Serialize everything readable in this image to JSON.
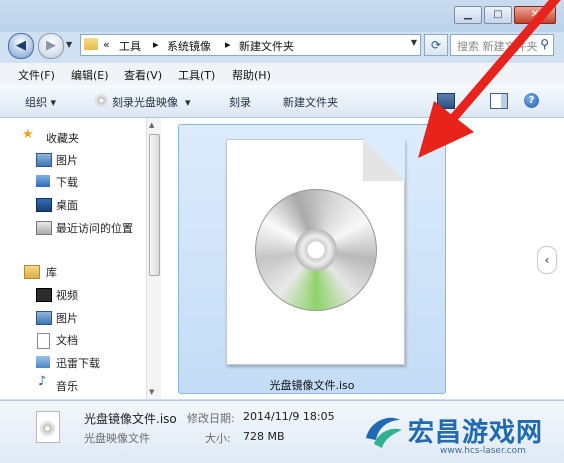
{
  "window": {
    "caption_buttons": [
      "minimize",
      "maximize",
      "close"
    ]
  },
  "address": {
    "overflow": "«",
    "crumbs": [
      "工具",
      "系统镜像",
      "新建文件夹"
    ],
    "search_placeholder": "搜索 新建文件夹"
  },
  "menu": [
    "文件(F)",
    "编辑(E)",
    "查看(V)",
    "工具(T)",
    "帮助(H)"
  ],
  "toolbar": {
    "organize": "组织",
    "burn_image": "刻录光盘映像",
    "burn": "刻录",
    "new_folder": "新建文件夹"
  },
  "nav": {
    "favorites": {
      "header": "收藏夹",
      "items": [
        "图片",
        "下载",
        "桌面",
        "最近访问的位置"
      ]
    },
    "library": {
      "header": "库",
      "items": [
        "视频",
        "图片",
        "文档",
        "迅雷下载",
        "音乐"
      ]
    }
  },
  "content": {
    "file_name": "光盘镜像文件.iso"
  },
  "details": {
    "name": "光盘镜像文件.iso",
    "type": "光盘映像文件",
    "modified_label": "修改日期:",
    "modified_value": "2014/11/9 18:05",
    "size_label": "大小:",
    "size_value": "728 MB"
  },
  "watermark": {
    "text": "宏昌游戏网",
    "url": "www.hcs-laser.com"
  },
  "colors": {
    "arrow": "#e8231c",
    "selection": "#cfe3f8",
    "watermark": "#1f6ab3"
  }
}
